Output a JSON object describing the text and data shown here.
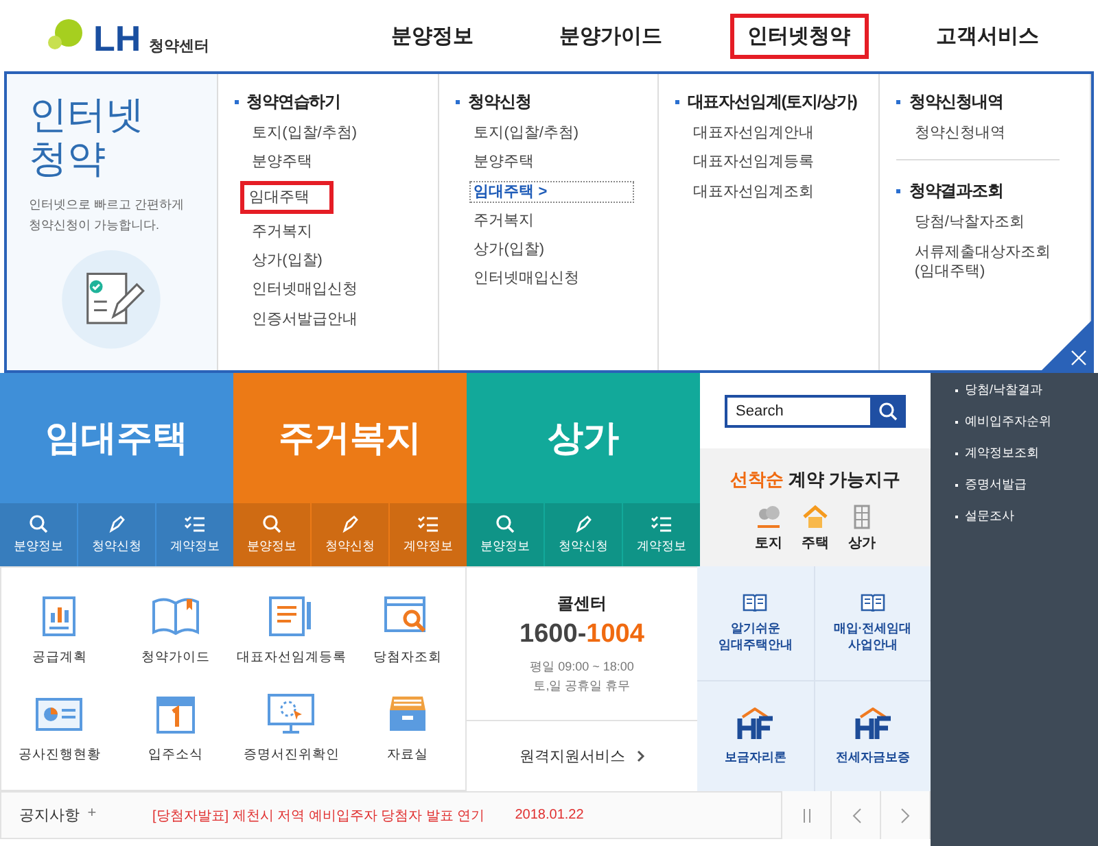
{
  "logo": {
    "mark": "LH",
    "caption": "청약센터"
  },
  "nav": [
    {
      "label": "분양정보",
      "highlighted": false
    },
    {
      "label": "분양가이드",
      "highlighted": false
    },
    {
      "label": "인터넷청약",
      "highlighted": true
    },
    {
      "label": "고객서비스",
      "highlighted": false
    }
  ],
  "panel": {
    "title_lines": [
      "인터넷",
      "청약"
    ],
    "description_lines": [
      "인터넷으로 빠르고 간편하게",
      "청약신청이 가능합니다."
    ],
    "columns": [
      {
        "sections": [
          {
            "heading": "청약연습하기",
            "links": [
              {
                "label": "토지(입찰/추첨)",
                "selected": false,
                "highlighted": false
              },
              {
                "label": "분양주택",
                "selected": false,
                "highlighted": false
              },
              {
                "label": "임대주택",
                "selected": false,
                "highlighted": true
              },
              {
                "label": "주거복지",
                "selected": false,
                "highlighted": false
              },
              {
                "label": "상가(입찰)",
                "selected": false,
                "highlighted": false
              },
              {
                "label": "인터넷매입신청",
                "selected": false,
                "highlighted": false
              },
              {
                "label": "인증서발급안내",
                "selected": false,
                "highlighted": false
              }
            ]
          }
        ]
      },
      {
        "sections": [
          {
            "heading": "청약신청",
            "links": [
              {
                "label": "토지(입찰/추첨)",
                "selected": false,
                "highlighted": false
              },
              {
                "label": "분양주택",
                "selected": false,
                "highlighted": false
              },
              {
                "label": "임대주택 >",
                "selected": true,
                "highlighted": false
              },
              {
                "label": "주거복지",
                "selected": false,
                "highlighted": false
              },
              {
                "label": "상가(입찰)",
                "selected": false,
                "highlighted": false
              },
              {
                "label": "인터넷매입신청",
                "selected": false,
                "highlighted": false
              }
            ]
          }
        ]
      },
      {
        "sections": [
          {
            "heading": "대표자선임계(토지/상가)",
            "links": [
              {
                "label": "대표자선임계안내",
                "selected": false,
                "highlighted": false
              },
              {
                "label": "대표자선임계등록",
                "selected": false,
                "highlighted": false
              },
              {
                "label": "대표자선임계조회",
                "selected": false,
                "highlighted": false
              }
            ]
          }
        ]
      },
      {
        "sections": [
          {
            "heading": "청약신청내역",
            "links": [
              {
                "label": "청약신청내역",
                "selected": false,
                "highlighted": false
              }
            ]
          },
          {
            "heading": "청약결과조회",
            "links": [
              {
                "label": "당첨/낙찰자조회",
                "selected": false,
                "highlighted": false
              },
              {
                "label": "서류제출대상자조회\n(임대주택)",
                "selected": false,
                "highlighted": false
              }
            ]
          }
        ]
      }
    ]
  },
  "tiles": [
    {
      "title": "임대주택",
      "color": "#3f8fd8",
      "actions": [
        "분양정보",
        "청약신청",
        "계약정보"
      ]
    },
    {
      "title": "주거복지",
      "color": "#ec7a16",
      "actions": [
        "분양정보",
        "청약신청",
        "계약정보"
      ]
    },
    {
      "title": "상가",
      "color": "#12a99a",
      "actions": [
        "분양정보",
        "청약신청",
        "계약정보"
      ]
    }
  ],
  "search": {
    "placeholder": "Search"
  },
  "contract": {
    "accent": "선착순",
    "title": "계약 가능지구",
    "options": [
      "토지",
      "주택",
      "상가"
    ]
  },
  "quick_links": [
    "공급계획",
    "청약가이드",
    "대표자선임계등록",
    "당첨자조회",
    "공사진행현황",
    "입주소식",
    "증명서진위확인",
    "자료실"
  ],
  "call_center": {
    "title": "콜센터",
    "number_prefix": "1600-",
    "number_suffix": "1004",
    "hours": [
      "평일 09:00 ~ 18:00",
      "토,일 공휴일 휴무"
    ],
    "remote": "원격지원서비스"
  },
  "guides": [
    {
      "kind": "book",
      "lines": [
        "알기쉬운",
        "임대주택안내"
      ]
    },
    {
      "kind": "book",
      "lines": [
        "매입·전세임대",
        "사업안내"
      ]
    },
    {
      "kind": "hf",
      "lines": [
        "보금자리론"
      ]
    },
    {
      "kind": "hf",
      "lines": [
        "전세자금보증"
      ]
    }
  ],
  "sidebar_links": [
    "당첨/낙찰결과",
    "예비입주자순위",
    "계약정보조회",
    "증명서발급",
    "설문조사"
  ],
  "notice": {
    "label": "공지사항",
    "more": "+",
    "title": "[당첨자발표] 제천시 저역 예비입주자 당첨자 발표 연기",
    "date": "2018.01.22"
  }
}
